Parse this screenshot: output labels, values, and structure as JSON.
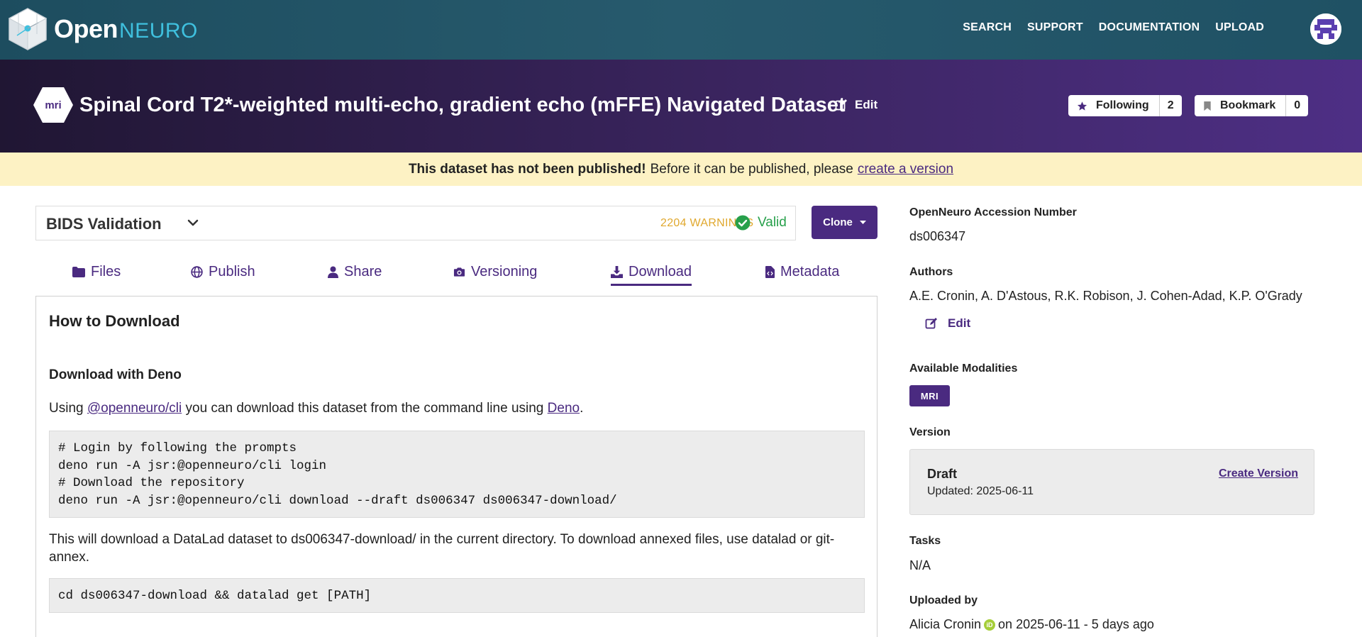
{
  "brand": {
    "open": "Open",
    "neuro": "NEURO"
  },
  "nav": {
    "links": [
      "SEARCH",
      "SUPPORT",
      "DOCUMENTATION",
      "UPLOAD"
    ]
  },
  "dataset": {
    "modality_icon": "mri",
    "title": "Spinal Cord T2*-weighted multi-echo, gradient echo (mFFE) Navigated Dataset",
    "edit_label": "Edit",
    "following_label": "Following",
    "following_count": "2",
    "bookmark_label": "Bookmark",
    "bookmark_count": "0"
  },
  "banner": {
    "bold": "This dataset has not been published!",
    "text": "Before it can be published, please",
    "link": "create a version"
  },
  "validation": {
    "title": "BIDS Validation",
    "warnings": "2204 WARNINGS",
    "status": "Valid",
    "clone_label": "Clone"
  },
  "tabs": [
    {
      "label": "Files",
      "icon": "folder-icon"
    },
    {
      "label": "Publish",
      "icon": "globe-icon"
    },
    {
      "label": "Share",
      "icon": "user-icon"
    },
    {
      "label": "Versioning",
      "icon": "camera-icon"
    },
    {
      "label": "Download",
      "icon": "download-icon",
      "active": true
    },
    {
      "label": "Metadata",
      "icon": "file-code-icon"
    }
  ],
  "download": {
    "heading": "How to Download",
    "subheading": "Download with Deno",
    "intro_pre": "Using",
    "intro_link1": "@openneuro/cli",
    "intro_mid": "you can download this dataset from the command line using",
    "intro_link2": "Deno",
    "intro_post": ".",
    "code1": [
      "# Login by following the prompts",
      "deno run -A jsr:@openneuro/cli login",
      "# Download the repository",
      "deno run -A jsr:@openneuro/cli download --draft ds006347 ds006347-download/"
    ],
    "note": "This will download a DataLad dataset to ds006347-download/ in the current directory. To download annexed files, use datalad or git-annex.",
    "code2": "cd ds006347-download && datalad get [PATH]"
  },
  "sidebar": {
    "accession_label": "OpenNeuro Accession Number",
    "accession_value": "ds006347",
    "authors_label": "Authors",
    "authors_value": "A.E. Cronin, A. D'Astous, R.K. Robison, J. Cohen-Adad, K.P. O'Grady",
    "authors_edit": "Edit",
    "modalities_label": "Available Modalities",
    "modality_badge": "MRI",
    "version_label": "Version",
    "version_name": "Draft",
    "version_updated": "Updated: 2025-06-11",
    "create_version": "Create Version",
    "tasks_label": "Tasks",
    "tasks_value": "N/A",
    "uploaded_label": "Uploaded by",
    "uploader": "Alicia Cronin",
    "orcid_icon": "iD",
    "uploaded_when": "on 2025-06-11 - 5 days ago"
  },
  "colors": {
    "accent": "#4a2a80",
    "valid": "#27a04b",
    "warning": "#e0a82e",
    "banner": "#fdf2c4"
  }
}
